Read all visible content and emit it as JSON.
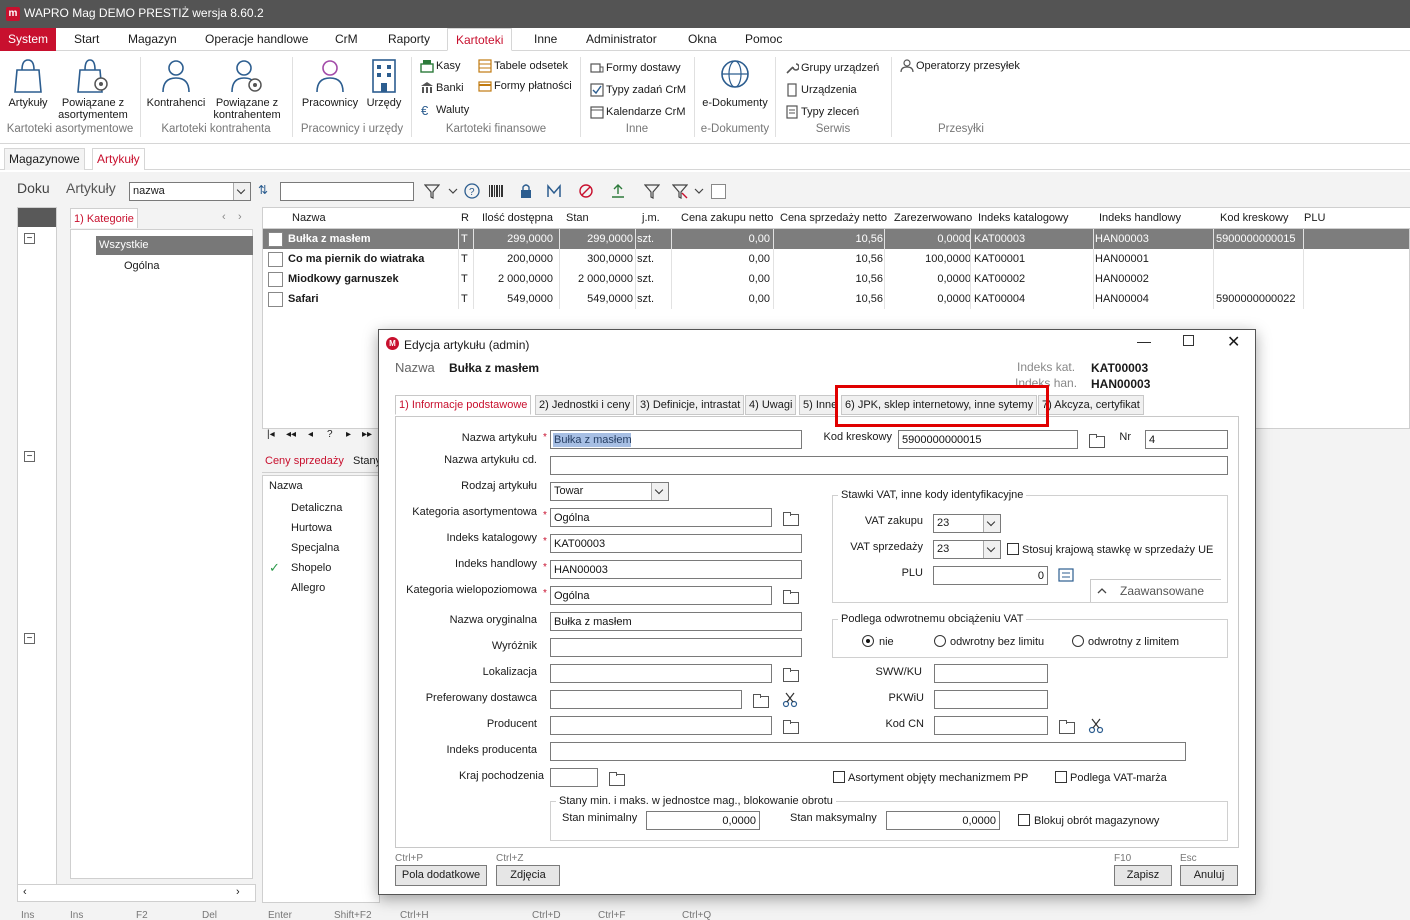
{
  "window": {
    "title": "WAPRO Mag DEMO PRESTIŻ  wersja 8.60.2",
    "logo": "m"
  },
  "menu": [
    "System",
    "Start",
    "Magazyn",
    "Operacje handlowe",
    "CrM",
    "Raporty",
    "Kartoteki",
    "Inne",
    "Administrator",
    "Okna",
    "Pomoc"
  ],
  "ribbon": {
    "artykuly": "Artykuły",
    "powiazane_asort_1": "Powiązane z",
    "powiazane_asort_2": "asortymentem",
    "grp_asort": "Kartoteki asortymentowe",
    "kontrahenci": "Kontrahenci",
    "powiazane_kontr_1": "Powiązane z",
    "powiazane_kontr_2": "kontrahentem",
    "grp_kontr": "Kartoteki kontrahenta",
    "pracownicy": "Pracownicy",
    "urzedy": "Urzędy",
    "grp_prac": "Pracownicy i urzędy",
    "kasy": "Kasy",
    "banki": "Banki",
    "waluty": "Waluty",
    "tabele": "Tabele odsetek",
    "formy_platnosci": "Formy płatności",
    "grp_fin": "Kartoteki finansowe",
    "formy_dostawy": "Formy dostawy",
    "typy_zadan": "Typy zadań CrM",
    "kalendarze": "Kalendarze CrM",
    "grp_inne": "Inne",
    "edokumenty": "e-Dokumenty",
    "grp_edok": "e-Dokumenty",
    "grupy_urzadzen": "Grupy urządzeń",
    "urzadzenia": "Urządzenia",
    "typy_zlecen": "Typy zleceń",
    "grp_serwis": "Serwis",
    "operatorzy": "Operatorzy przesyłek",
    "grp_przesylki": "Przesyłki"
  },
  "doc_tabs": [
    "Magazynowe",
    "Artykuły"
  ],
  "left_panel": {
    "doku": "Doku",
    "title": "Artykuły",
    "search_field": "nazwa",
    "cat_tab": "1) Kategorie",
    "tree_root": "Wszystkie",
    "tree_child": "Ogólna"
  },
  "table": {
    "columns": [
      "Nazwa",
      "R",
      "Ilość dostępna",
      "Stan",
      "j.m.",
      "Cena zakupu netto",
      "Cena sprzedaży netto",
      "Zarezerwowano",
      "Indeks katalogowy",
      "Indeks handlowy",
      "Kod kreskowy",
      "PLU"
    ],
    "rows": [
      [
        "Bułka z masłem",
        "T",
        "299,0000",
        "299,0000",
        "szt.",
        "0,00",
        "10,56",
        "0,0000",
        "KAT00003",
        "HAN00003",
        "5900000000015",
        ""
      ],
      [
        "Co ma piernik do wiatraka",
        "T",
        "200,0000",
        "300,0000",
        "szt.",
        "0,00",
        "10,56",
        "100,0000",
        "KAT00001",
        "HAN00001",
        "",
        ""
      ],
      [
        "Miodkowy garnuszek",
        "T",
        "2 000,0000",
        "2 000,0000",
        "szt.",
        "0,00",
        "10,56",
        "0,0000",
        "KAT00002",
        "HAN00002",
        "",
        ""
      ],
      [
        "Safari",
        "T",
        "549,0000",
        "549,0000",
        "szt.",
        "0,00",
        "10,56",
        "0,0000",
        "KAT00004",
        "HAN00004",
        "5900000000022",
        ""
      ]
    ]
  },
  "price_panel": {
    "tab1": "Ceny sprzedaży",
    "tab2": "Stany",
    "col": "Nazwa",
    "items": [
      "Detaliczna",
      "Hurtowa",
      "Specjalna",
      "Shopelo",
      "Allegro"
    ]
  },
  "statusbar": [
    "Ins",
    "Ins",
    "F2",
    "Del",
    "Enter",
    "Shift+F2",
    "Ctrl+H",
    "Ctrl+D",
    "Ctrl+F",
    "Ctrl+Q"
  ],
  "dialog": {
    "title": "Edycja artykułu (admin)",
    "nazwa_lbl": "Nazwa",
    "nazwa_val": "Bułka z masłem",
    "idx_kat_lbl": "Indeks kat.",
    "idx_kat_val": "KAT00003",
    "idx_han_lbl": "Indeks han.",
    "idx_han_val": "HAN00003",
    "tabs": [
      "1) Informacje podstawowe",
      "2) Jednostki i ceny",
      "3) Definicje, intrastat",
      "4) Uwagi",
      "5) Inne",
      "6) JPK, sklep internetowy, inne sytemy",
      "7) Akcyza, certyfikat"
    ],
    "highlight_color": "#e00000",
    "labels": {
      "nazwa_art": "Nazwa artykułu",
      "nazwa_cd": "Nazwa artykułu cd.",
      "rodzaj": "Rodzaj artykułu",
      "kat_asort": "Kategoria asortymentowa",
      "idx_kat": "Indeks katalogowy",
      "idx_han": "Indeks handlowy",
      "kat_wielo": "Kategoria wielopoziomowa",
      "nazwa_oryg": "Nazwa oryginalna",
      "wyroznik": "Wyróżnik",
      "lokalizacja": "Lokalizacja",
      "pref_dost": "Preferowany dostawca",
      "producent": "Producent",
      "idx_prod": "Indeks producenta",
      "kraj": "Kraj pochodzenia",
      "kod_kresk": "Kod kreskowy",
      "nr": "Nr",
      "vat_zak": "VAT zakupu",
      "vat_sprz": "VAT sprzedaży",
      "plu": "PLU",
      "sww": "SWW/KU",
      "pkwiu": "PKWiU",
      "kodcn": "Kod CN",
      "stan_min": "Stan minimalny",
      "stan_maks": "Stan maksymalny"
    },
    "values": {
      "nazwa_art": "Bułka z masłem",
      "rodzaj": "Towar",
      "kat_asort": "Ogólna",
      "idx_kat": "KAT00003",
      "idx_han": "HAN00003",
      "kat_wielo": "Ogólna",
      "nazwa_oryg": "Bułka z masłem",
      "kod_kresk": "5900000000015",
      "nr": "4",
      "vat_zak": "23",
      "vat_sprz": "23",
      "plu": "0",
      "stan_min": "0,0000",
      "stan_maks": "0,0000"
    },
    "group_vat": "Stawki VAT, inne kody identyfikacyjne",
    "stosuj": "Stosuj krajową stawkę w sprzedaży UE",
    "zaawansowane": "Zaawansowane",
    "group_odwr": "Podlega odwrotnemu obciążeniu VAT",
    "radio": [
      "nie",
      "odwrotny bez limitu",
      "odwrotny z limitem"
    ],
    "asort_pp": "Asortyment objęty mechanizmem PP",
    "vat_marza": "Podlega VAT-marża",
    "group_stany": "Stany min. i maks. w jednostce mag., blokowanie obrotu",
    "blokuj": "Blokuj obrót magazynowy",
    "btn_pola": "Pola dodatkowe",
    "sc_pola": "Ctrl+P",
    "btn_zdjecia": "Zdjęcia",
    "sc_zdjecia": "Ctrl+Z",
    "btn_zapisz": "Zapisz",
    "sc_zapisz": "F10",
    "btn_anuluj": "Anuluj",
    "sc_anuluj": "Esc"
  }
}
